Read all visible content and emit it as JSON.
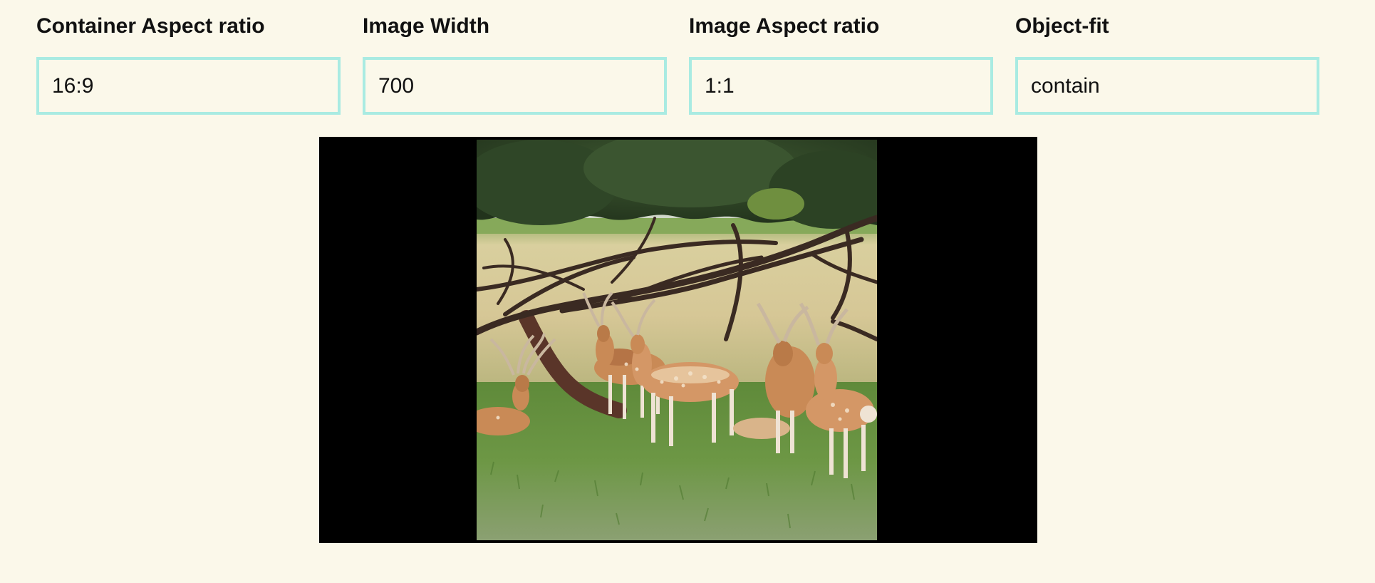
{
  "controls": {
    "container_aspect": {
      "label": "Container Aspect ratio",
      "value": "16:9"
    },
    "image_width": {
      "label": "Image Width",
      "value": "700"
    },
    "image_aspect": {
      "label": "Image Aspect ratio",
      "value": "1:1"
    },
    "object_fit": {
      "label": "Object-fit",
      "value": "contain"
    }
  },
  "preview": {
    "image_subject": "deer-herd-under-tree-photo"
  },
  "colors": {
    "background": "#fbf8ea",
    "input_border": "#a9ebe2",
    "container_fill": "#000000"
  }
}
